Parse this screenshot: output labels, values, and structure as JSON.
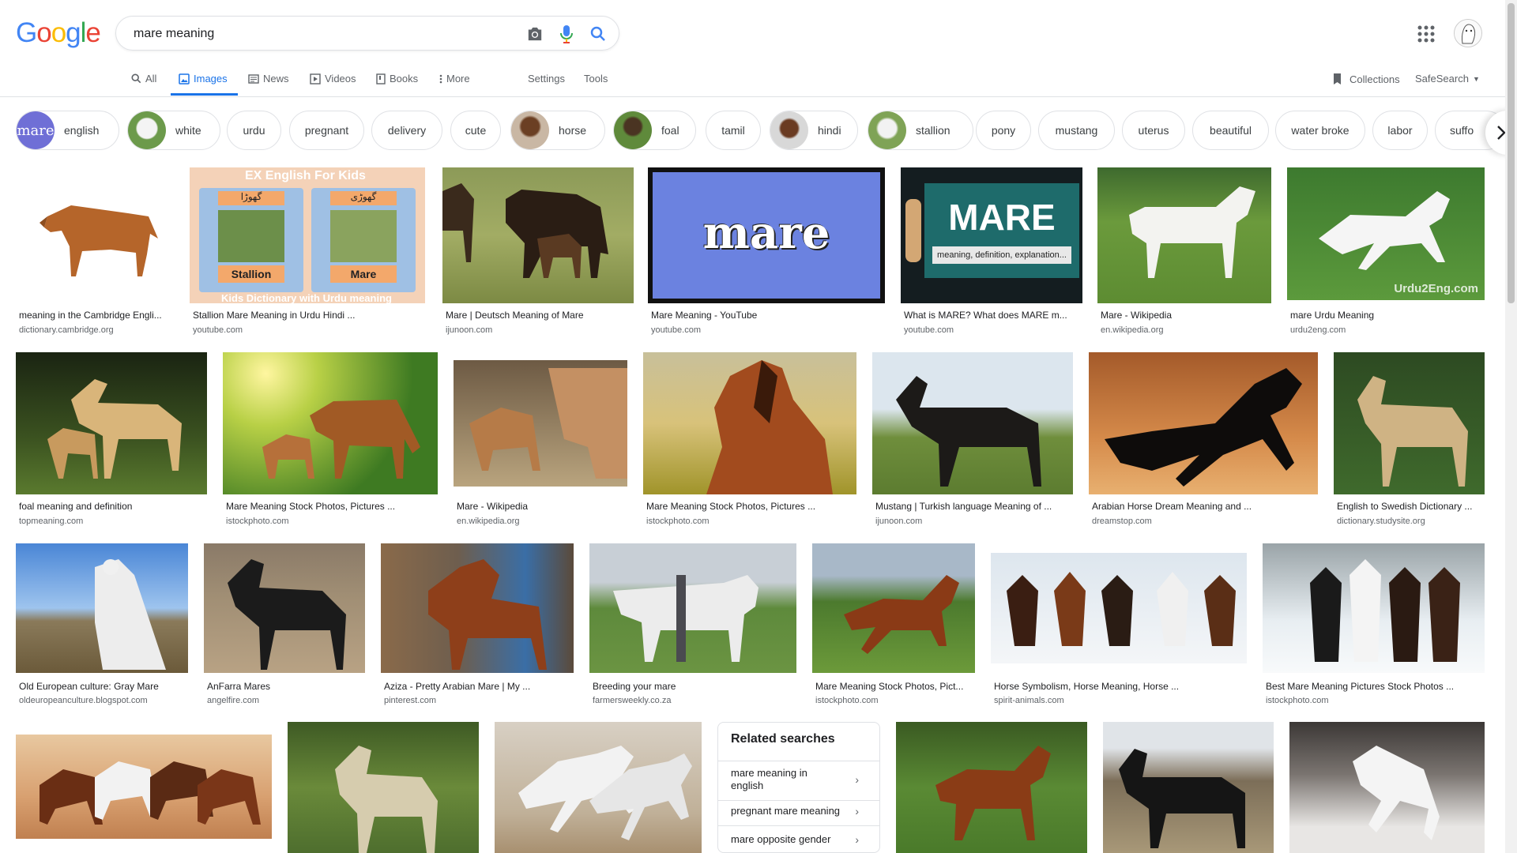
{
  "header": {
    "logo_letters": [
      "G",
      "o",
      "o",
      "g",
      "l",
      "e"
    ],
    "logo_colors": [
      "#4285F4",
      "#EA4335",
      "#FBBC05",
      "#4285F4",
      "#34A853",
      "#EA4335"
    ],
    "search_value": "mare meaning"
  },
  "tabs": {
    "all": "All",
    "images": "Images",
    "news": "News",
    "videos": "Videos",
    "books": "Books",
    "more": "More",
    "settings": "Settings",
    "tools": "Tools",
    "collections": "Collections",
    "safesearch": "SafeSearch"
  },
  "chips": [
    "english",
    "white",
    "urdu",
    "pregnant",
    "delivery",
    "cute",
    "horse",
    "foal",
    "tamil",
    "hindi",
    "stallion",
    "pony",
    "mustang",
    "uterus",
    "beautiful",
    "water broke",
    "labor",
    "suffo"
  ],
  "chip_thumb_text": "mare",
  "results_row1": [
    {
      "title": "meaning in the Cambridge Engli...",
      "source": "dictionary.cambridge.org"
    },
    {
      "title": "Stallion Mare Meaning in Urdu Hindi ...",
      "source": "youtube.com",
      "overlay_top": "EX English For Kids",
      "overlay_urdu_left": "گھوڑا",
      "overlay_urdu_right": "گھوڑی",
      "label_left": "Stallion",
      "label_right": "Mare",
      "overlay_bottom": "Kids Dictionary with Urdu meaning"
    },
    {
      "title": "Mare | Deutsch Meaning of Mare",
      "source": "ijunoon.com"
    },
    {
      "title": "Mare Meaning - YouTube",
      "source": "youtube.com",
      "overlay": "mare"
    },
    {
      "title": "What is MARE? What does MARE m...",
      "source": "youtube.com",
      "overlay": "MARE",
      "overlay_sub": "meaning, definition, explanation..."
    },
    {
      "title": "Mare - Wikipedia",
      "source": "en.wikipedia.org"
    },
    {
      "title": "mare Urdu Meaning",
      "source": "urdu2eng.com",
      "overlay": "Urdu2Eng.com"
    }
  ],
  "results_row2": [
    {
      "title": "foal meaning and definition",
      "source": "topmeaning.com"
    },
    {
      "title": "Mare Meaning Stock Photos, Pictures ...",
      "source": "istockphoto.com"
    },
    {
      "title": "Mare - Wikipedia",
      "source": "en.wikipedia.org"
    },
    {
      "title": "Mare Meaning Stock Photos, Pictures ...",
      "source": "istockphoto.com"
    },
    {
      "title": "Mustang | Turkish language Meaning of ...",
      "source": "ijunoon.com"
    },
    {
      "title": "Arabian Horse Dream Meaning and ...",
      "source": "dreamstop.com"
    },
    {
      "title": "English to Swedish Dictionary ...",
      "source": "dictionary.studysite.org"
    }
  ],
  "results_row3": [
    {
      "title": "Old European culture: Gray Mare",
      "source": "oldeuropeanculture.blogspot.com"
    },
    {
      "title": "AnFarra Mares",
      "source": "angelfire.com"
    },
    {
      "title": "Aziza - Pretty Arabian Mare | My ...",
      "source": "pinterest.com"
    },
    {
      "title": "Breeding your mare",
      "source": "farmersweekly.co.za"
    },
    {
      "title": "Mare Meaning Stock Photos, Pict...",
      "source": "istockphoto.com"
    },
    {
      "title": "Horse Symbolism, Horse Meaning, Horse ...",
      "source": "spirit-animals.com"
    },
    {
      "title": "Best Mare Meaning Pictures Stock Photos ...",
      "source": "istockphoto.com"
    }
  ],
  "related": {
    "heading": "Related searches",
    "items": [
      "mare meaning in english",
      "pregnant mare meaning",
      "mare opposite gender"
    ]
  }
}
